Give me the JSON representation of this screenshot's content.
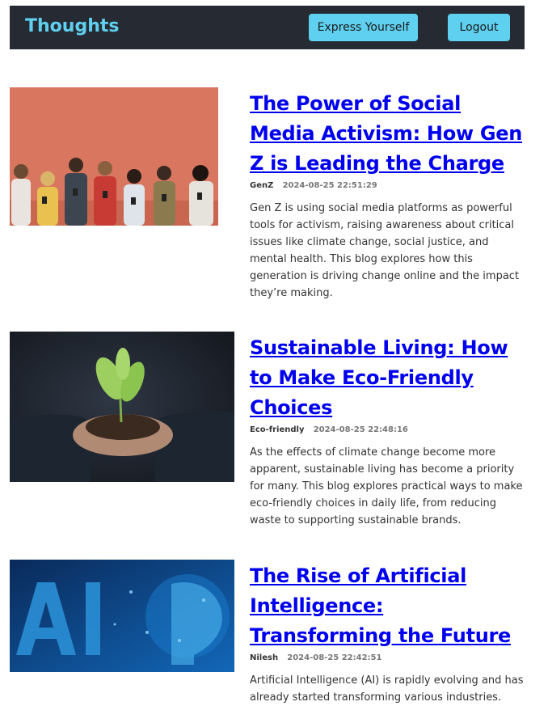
{
  "nav": {
    "brand": "Thoughts",
    "express_label": "Express Yourself",
    "logout_label": "Logout"
  },
  "posts": [
    {
      "title": "The Power of Social Media Activism: How Gen Z is Leading the Charge",
      "author": "GenZ",
      "date": "2024-08-25 22:51:29",
      "excerpt": "Gen Z is using social media platforms as powerful tools for activism, raising awareness about critical issues like climate change, social justice, and mental health. This blog explores how this generation is driving change online and the impact they’re making.",
      "image": "group-with-phones-image"
    },
    {
      "title": "Sustainable Living: How to Make Eco-Friendly Choices",
      "author": "Eco-friendly",
      "date": "2024-08-25 22:48:16",
      "excerpt": "As the effects of climate change become more apparent, sustainable living has become a priority for many. This blog explores practical ways to make eco-friendly choices in daily life, from reducing waste to supporting sustainable brands.",
      "image": "seedling-in-hands-image"
    },
    {
      "title": "The Rise of Artificial Intelligence: Transforming the Future",
      "author": "Nilesh",
      "date": "2024-08-25 22:42:51",
      "excerpt": "Artificial Intelligence (AI) is rapidly evolving and has already started transforming various industries.",
      "image": "ai-head-image"
    }
  ]
}
